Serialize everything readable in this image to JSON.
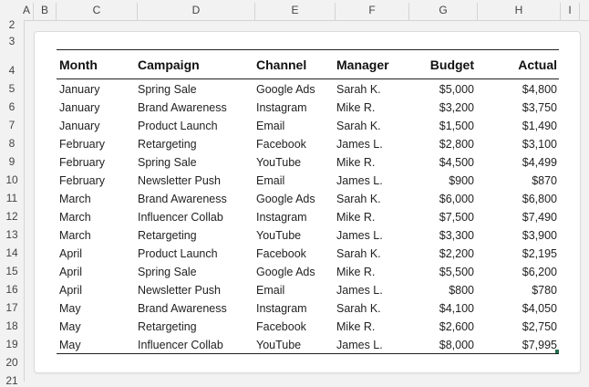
{
  "columns": [
    "A",
    "B",
    "C",
    "D",
    "E",
    "F",
    "G",
    "H",
    "I"
  ],
  "rows": [
    "2",
    "3",
    "4",
    "5",
    "6",
    "7",
    "8",
    "9",
    "10",
    "11",
    "12",
    "13",
    "14",
    "15",
    "16",
    "17",
    "18",
    "19",
    "20",
    "21"
  ],
  "table": {
    "headers": {
      "month": "Month",
      "campaign": "Campaign",
      "channel": "Channel",
      "manager": "Manager",
      "budget": "Budget",
      "actual": "Actual"
    },
    "rows": [
      {
        "month": "January",
        "campaign": "Spring Sale",
        "channel": "Google Ads",
        "manager": "Sarah K.",
        "budget": "$5,000",
        "actual": "$4,800"
      },
      {
        "month": "January",
        "campaign": "Brand Awareness",
        "channel": "Instagram",
        "manager": "Mike R.",
        "budget": "$3,200",
        "actual": "$3,750"
      },
      {
        "month": "January",
        "campaign": "Product Launch",
        "channel": "Email",
        "manager": "Sarah K.",
        "budget": "$1,500",
        "actual": "$1,490"
      },
      {
        "month": "February",
        "campaign": "Retargeting",
        "channel": "Facebook",
        "manager": "James L.",
        "budget": "$2,800",
        "actual": "$3,100"
      },
      {
        "month": "February",
        "campaign": "Spring Sale",
        "channel": "YouTube",
        "manager": "Mike R.",
        "budget": "$4,500",
        "actual": "$4,499"
      },
      {
        "month": "February",
        "campaign": "Newsletter Push",
        "channel": "Email",
        "manager": "James L.",
        "budget": "$900",
        "actual": "$870"
      },
      {
        "month": "March",
        "campaign": "Brand Awareness",
        "channel": "Google Ads",
        "manager": "Sarah K.",
        "budget": "$6,000",
        "actual": "$6,800"
      },
      {
        "month": "March",
        "campaign": "Influencer Collab",
        "channel": "Instagram",
        "manager": "Mike R.",
        "budget": "$7,500",
        "actual": "$7,490"
      },
      {
        "month": "March",
        "campaign": "Retargeting",
        "channel": "YouTube",
        "manager": "James L.",
        "budget": "$3,300",
        "actual": "$3,900"
      },
      {
        "month": "April",
        "campaign": "Product Launch",
        "channel": "Facebook",
        "manager": "Sarah K.",
        "budget": "$2,200",
        "actual": "$2,195"
      },
      {
        "month": "April",
        "campaign": "Spring Sale",
        "channel": "Google Ads",
        "manager": "Mike R.",
        "budget": "$5,500",
        "actual": "$6,200"
      },
      {
        "month": "April",
        "campaign": "Newsletter Push",
        "channel": "Email",
        "manager": "James L.",
        "budget": "$800",
        "actual": "$780"
      },
      {
        "month": "May",
        "campaign": "Brand Awareness",
        "channel": "Instagram",
        "manager": "Sarah K.",
        "budget": "$4,100",
        "actual": "$4,050"
      },
      {
        "month": "May",
        "campaign": "Retargeting",
        "channel": "Facebook",
        "manager": "Mike R.",
        "budget": "$2,600",
        "actual": "$2,750"
      },
      {
        "month": "May",
        "campaign": "Influencer Collab",
        "channel": "YouTube",
        "manager": "James L.",
        "budget": "$8,000",
        "actual": "$7,995"
      }
    ]
  },
  "colors": {
    "accent": "#1f6f4a",
    "rule": "#222222"
  }
}
